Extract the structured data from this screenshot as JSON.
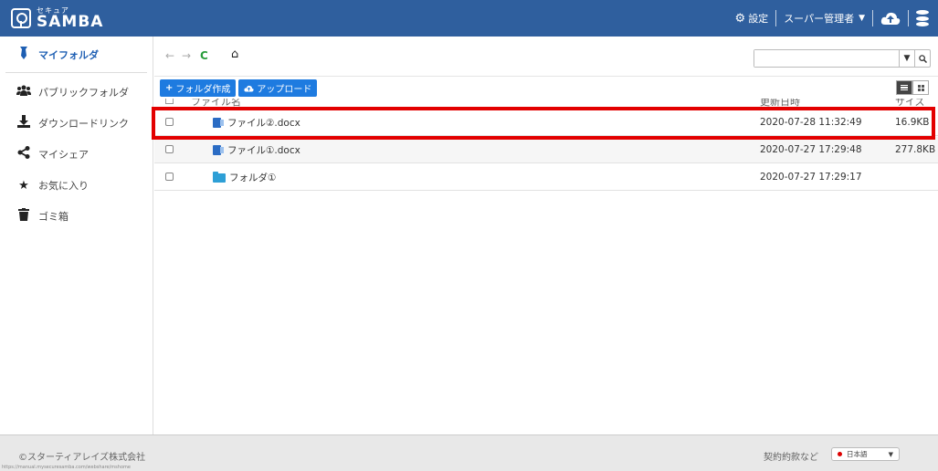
{
  "header": {
    "logo_kana": "セキュア",
    "logo_name": "SAMBA",
    "settings_label": "設定",
    "user_label": "スーパー管理者",
    "icons": [
      "gear-icon",
      "chevron-down-icon",
      "cloud-upload-icon",
      "database-icon"
    ]
  },
  "sidebar": {
    "items": [
      {
        "label": "マイフォルダ",
        "icon": "tie-icon",
        "active": true
      },
      {
        "label": "パブリックフォルダ",
        "icon": "users-icon"
      },
      {
        "label": "ダウンロードリンク",
        "icon": "download-icon"
      },
      {
        "label": "マイシェア",
        "icon": "share-icon"
      },
      {
        "label": "お気に入り",
        "icon": "star-icon"
      },
      {
        "label": "ゴミ箱",
        "icon": "trash-icon"
      }
    ]
  },
  "toolbar": {
    "back_glyph": "←",
    "forward_glyph": "→",
    "refresh_glyph": "C",
    "home_glyph": "⌂",
    "search_value": "",
    "search_placeholder": "",
    "create_folder_label": "フォルダ作成",
    "upload_label": "アップロード",
    "view_mode": "list"
  },
  "table": {
    "columns": [
      "ファイル名",
      "更新日時",
      "サイズ"
    ],
    "rows": [
      {
        "name": "ファイル②.docx",
        "type": "word",
        "date": "2020-07-28 11:32:49",
        "size": "16.9KB",
        "highlighted": true
      },
      {
        "name": "ファイル①.docx",
        "type": "word",
        "date": "2020-07-27 17:29:48",
        "size": "277.8KB"
      },
      {
        "name": "フォルダ①",
        "type": "folder",
        "date": "2020-07-27 17:29:17",
        "size": ""
      }
    ]
  },
  "footer": {
    "copyright": "©スターティアレイズ株式会社",
    "url": "https://manual.mysecuresamba.com/webshare/mshome",
    "terms_label": "契約約款など",
    "language": "日本語"
  },
  "colors": {
    "header_bg": "#2f5f9e",
    "accent": "#1e7be0",
    "highlight": "#e30000"
  }
}
